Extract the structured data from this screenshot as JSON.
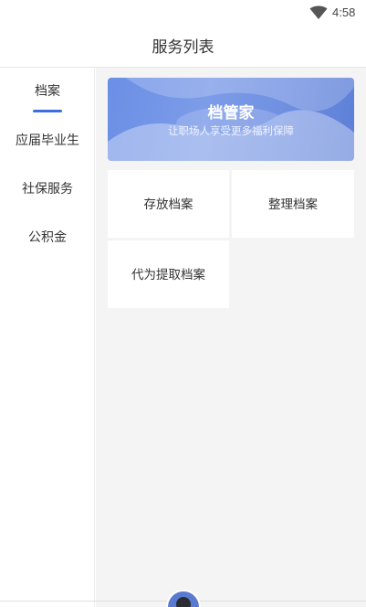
{
  "status_bar": {
    "time": "4:58",
    "wifi_icon": "wifi-icon"
  },
  "header": {
    "title": "服务列表"
  },
  "sidebar": {
    "items": [
      {
        "label": "档案",
        "active": true
      },
      {
        "label": "应届毕业生",
        "active": false
      },
      {
        "label": "社保服务",
        "active": false
      },
      {
        "label": "公积金",
        "active": false
      }
    ],
    "accent": "#3b6fe0"
  },
  "banner": {
    "title": "档管家",
    "subtitle": "让职场人享受更多福利保障",
    "color": "#7393e6"
  },
  "services": [
    {
      "label": "存放档案"
    },
    {
      "label": "整理档案"
    },
    {
      "label": "代为提取档案"
    }
  ]
}
